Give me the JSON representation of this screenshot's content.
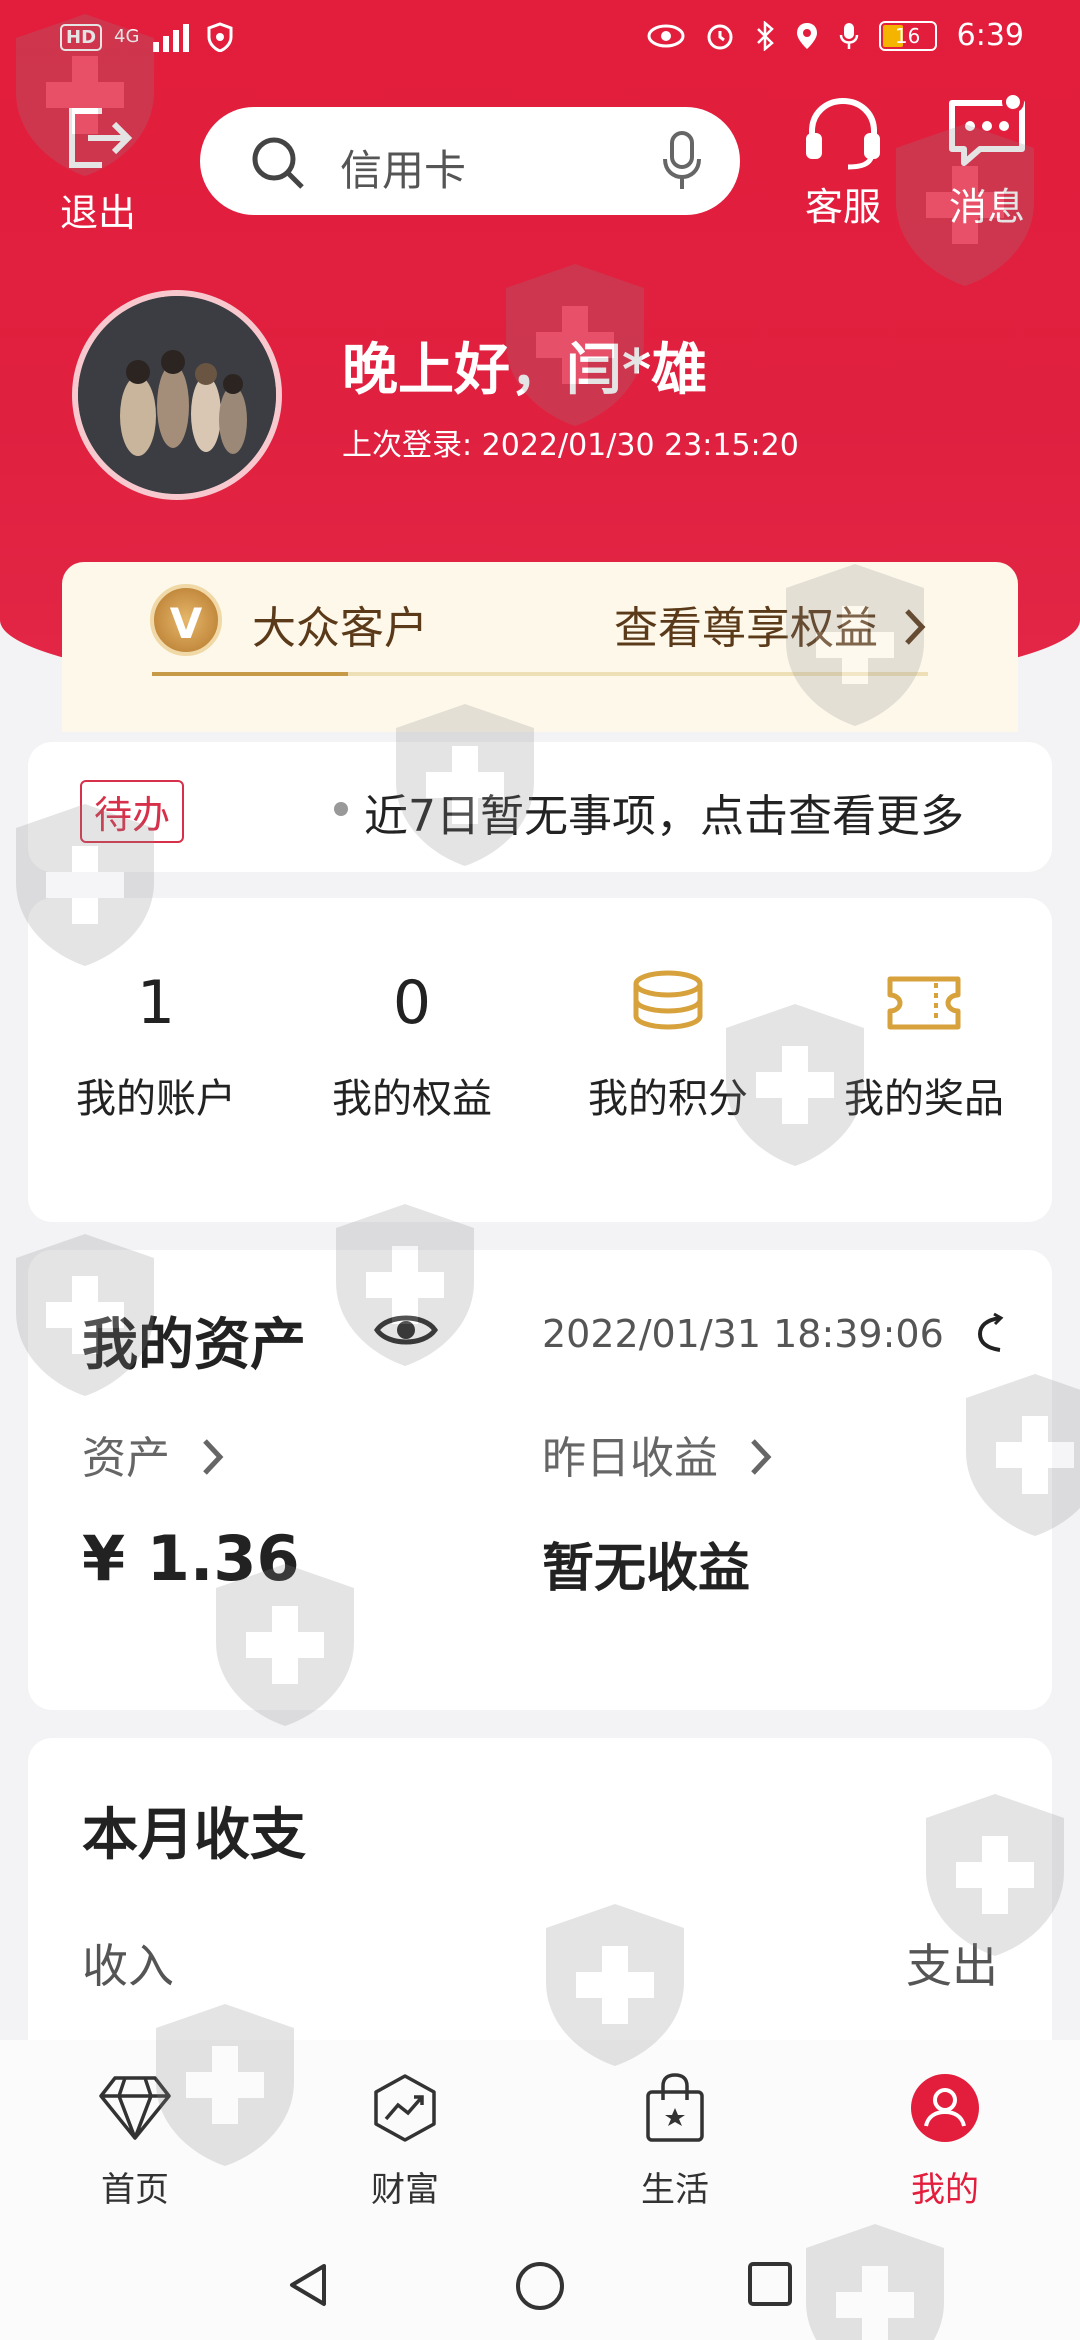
{
  "status_bar": {
    "hd": "HD",
    "network": "4G",
    "time": "6:39",
    "battery": "16"
  },
  "top_bar": {
    "logout_label": "退出",
    "search_placeholder": "信用卡",
    "service_label": "客服",
    "messages_label": "消息"
  },
  "profile": {
    "greeting": "晚上好，闫*雄",
    "last_login": "上次登录: 2022/01/30 23:15:20"
  },
  "vip": {
    "badge": "V",
    "level": "大众客户",
    "link": "查看尊享权益"
  },
  "todo": {
    "tag": "待办",
    "text": "近7日暂无事项，点击查看更多"
  },
  "quick": [
    {
      "value": "1",
      "label": "我的账户"
    },
    {
      "value": "0",
      "label": "我的权益"
    },
    {
      "icon": "coins-icon",
      "label": "我的积分"
    },
    {
      "icon": "ticket-icon",
      "label": "我的奖品"
    }
  ],
  "assets": {
    "title": "我的资产",
    "time": "2022/01/31 18:39:06",
    "asset_label": "资产",
    "asset_value": "¥ 1.36",
    "yesterday_label": "昨日收益",
    "yesterday_value": "暂无收益"
  },
  "month": {
    "title": "本月收支",
    "income": "收入",
    "expense": "支出"
  },
  "tabs": [
    {
      "label": "首页",
      "icon": "diamond-icon"
    },
    {
      "label": "财富",
      "icon": "wealth-icon"
    },
    {
      "label": "生活",
      "icon": "shopping-bag-icon"
    },
    {
      "label": "我的",
      "icon": "user-icon",
      "active": true
    }
  ],
  "colors": {
    "brand_red": "#e31d3c",
    "gold": "#c69a46"
  }
}
